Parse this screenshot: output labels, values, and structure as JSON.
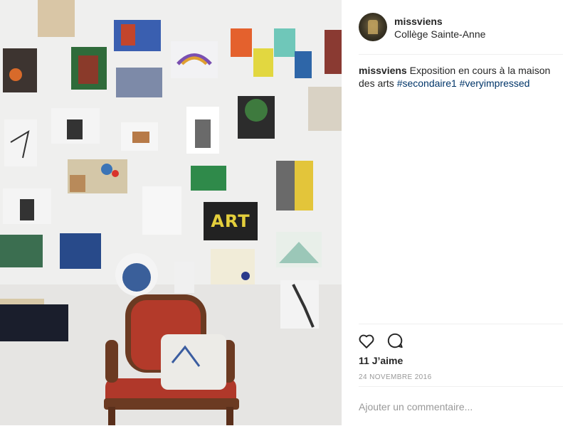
{
  "post": {
    "username": "missviens",
    "location": "Collège Sainte-Anne",
    "caption_text": "Exposition en cours à la maison des arts",
    "hashtags": [
      "#secondaire1",
      "#veryimpressed"
    ],
    "likes": "11 J’aime",
    "date": "24 NOVEMBRE 2016"
  },
  "photo": {
    "art_label": "ART"
  },
  "actions": {
    "like_icon": "heart-icon",
    "comment_icon": "comment-bubble-icon"
  },
  "comment": {
    "placeholder": "Ajouter un commentaire..."
  },
  "colors": {
    "hashtag": "#003569",
    "divider": "#efefef",
    "muted": "#999999"
  }
}
